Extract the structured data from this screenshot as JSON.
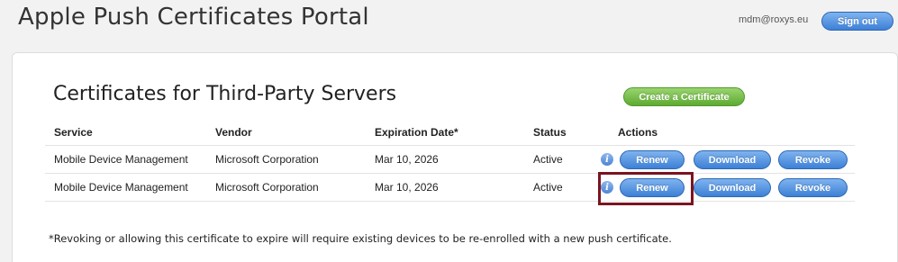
{
  "header": {
    "title": "Apple Push Certificates Portal",
    "user_email": "mdm@roxys.eu",
    "sign_out_label": "Sign out"
  },
  "section": {
    "title": "Certificates for Third-Party Servers",
    "create_label": "Create a Certificate"
  },
  "table": {
    "columns": [
      "Service",
      "Vendor",
      "Expiration Date*",
      "Status",
      "Actions"
    ],
    "rows": [
      {
        "service": "Mobile Device Management",
        "vendor": "Microsoft Corporation",
        "expiration": "Mar 10, 2026",
        "status": "Active",
        "info_icon": "info-icon",
        "actions": [
          "Renew",
          "Download",
          "Revoke"
        ]
      },
      {
        "service": "Mobile Device Management",
        "vendor": "Microsoft Corporation",
        "expiration": "Mar 10, 2026",
        "status": "Active",
        "info_icon": "info-icon",
        "actions": [
          "Renew",
          "Download",
          "Revoke"
        ]
      }
    ]
  },
  "footnote": "*Revoking or allowing this certificate to expire will require existing devices to be re-enrolled with a new push certificate.",
  "colors": {
    "primary_button": "#3d80d6",
    "create_button": "#5daa31",
    "highlight": "#7a1420"
  }
}
